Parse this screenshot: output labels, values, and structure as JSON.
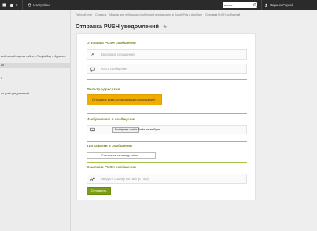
{
  "topbar": {
    "home_count": "8",
    "settings_label": "Настройки",
    "search_value": "поиск...",
    "user_name": "Черных Сергей"
  },
  "sidebar": {
    "items": [
      {
        "label": "мобильной версии сайта в GooglePlay и Appstore"
      },
      {
        "label": "ий"
      },
      {
        "label": "о"
      },
      {
        "label": "ия push уведомлений"
      }
    ]
  },
  "breadcrumb": {
    "items": [
      "Рабочий стол",
      "Сервисы",
      "Модуль для публикации Мобильной версии сайта в GooglePlay и AppStore",
      "Отправка PUSH сообщений"
    ]
  },
  "page": {
    "title": "Отправка PUSH уведомлений",
    "star": "★"
  },
  "sections": {
    "push_title": "Отправка PUSH сообщения",
    "title_placeholder": "Заголовок сообщения",
    "text_placeholder": "Текст сообщения",
    "filter_title": "Фильтр адресатов",
    "filter_button": "Отправить всем (установившим приложение)",
    "image_title": "Изображение в сообщении",
    "file_button": "Выберите файл",
    "file_status": "Файл не выбран",
    "link_type_title": "Тип ссылки в сообщении",
    "link_type_selected": "Ссылка на страницу сайта",
    "link_title": "Ссылка в PUSH сообщении",
    "link_placeholder": "Введите ссылку на сайт (с http)",
    "submit": "Отправить"
  },
  "icons": {
    "title_field": "font-icon",
    "text_field": "speech-bubble-icon",
    "image_field": "image-icon",
    "link_field": "link-icon"
  },
  "colors": {
    "accent": "#7a9d14",
    "section_title": "#6c8a1f",
    "warning_button": "#f0ad00",
    "topbar": "#2b2b2b"
  }
}
